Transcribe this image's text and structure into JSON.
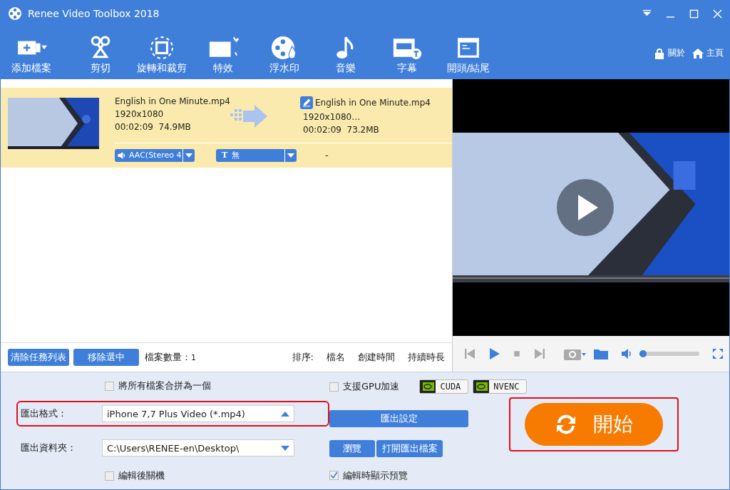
{
  "window": {
    "title": "Renee Video Toolbox 2018"
  },
  "toolbar": {
    "items": [
      {
        "label": "添加檔案",
        "kind": "add"
      },
      {
        "label": "剪切",
        "kind": "cut"
      },
      {
        "label": "旋轉和裁剪",
        "kind": "crop"
      },
      {
        "label": "特效",
        "kind": "effect"
      },
      {
        "label": "浮水印",
        "kind": "watermark"
      },
      {
        "label": "音樂",
        "kind": "music"
      },
      {
        "label": "字幕",
        "kind": "subtitle"
      },
      {
        "label": "開頭/結尾",
        "kind": "intro"
      }
    ],
    "links": [
      {
        "label": "關於",
        "kind": "lock"
      },
      {
        "label": "主頁",
        "kind": "home"
      }
    ]
  },
  "task": {
    "selected": true,
    "source": {
      "name": "English in One Minute.mp4",
      "resolution": "1920x1080",
      "duration": "00:02:09",
      "size": "74.9MB"
    },
    "output": {
      "name": "English in One Minute.mp4",
      "resolution": "1920x1080…",
      "duration": "00:02:09",
      "size": "73.2MB"
    },
    "audio": "AAC(Stereo 4",
    "subtitle_icon": "T",
    "subtitle": "無",
    "extra": "-"
  },
  "list_bar": {
    "clear": "清除任務列表",
    "remove": "移除選中",
    "count_label": "檔案數量：",
    "count": "1",
    "sort_label": "排序:",
    "sort_options": [
      "檔名",
      "創建時間",
      "持續時長"
    ]
  },
  "player": {
    "volume": {
      "level": 0.06
    }
  },
  "settings": {
    "merge": {
      "label": "將所有檔案合拼為一個",
      "checked": false
    },
    "gpu": {
      "label": "支援GPU加速",
      "checked": false
    },
    "badges": [
      "CUDA",
      "NVENC"
    ],
    "format": {
      "label": "匯出格式：",
      "value": "iPhone 7,7 Plus Video (*.mp4)",
      "highlighted": true
    },
    "format_settings": "匯出設定",
    "folder": {
      "label": "匯出資料夾：",
      "value": "C:\\Users\\RENEE-en\\Desktop\\"
    },
    "browse": "瀏覽",
    "open": "打開匯出檔案",
    "shutdown": {
      "label": "編輯後關機",
      "checked": false
    },
    "preview": {
      "label": "編輯時顯示預覽",
      "checked": true
    },
    "start": {
      "label": "開始",
      "highlighted": true
    }
  }
}
